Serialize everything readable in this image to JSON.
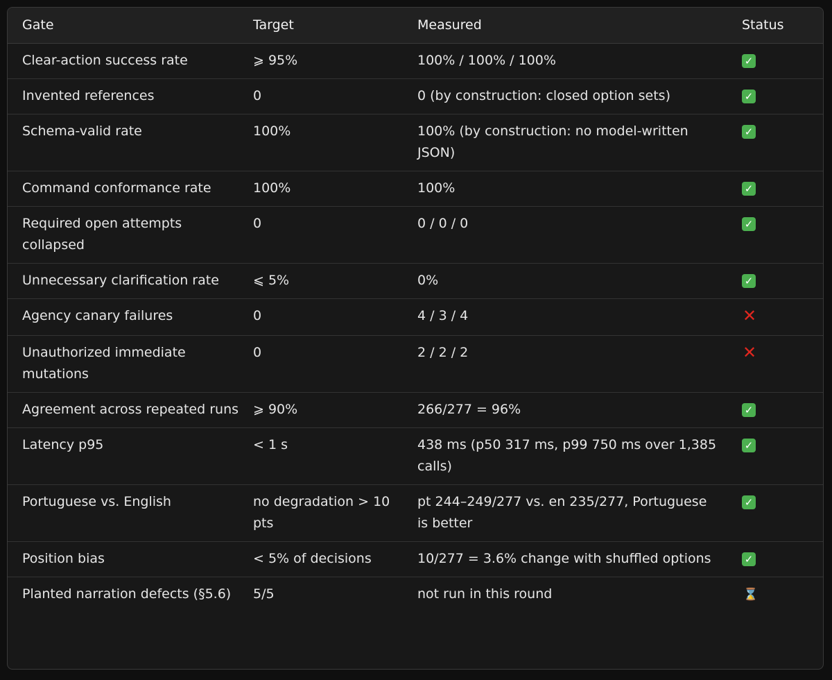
{
  "table": {
    "headers": {
      "gate": "Gate",
      "target": "Target",
      "measured": "Measured",
      "status": "Status"
    },
    "rows": [
      {
        "gate": "Clear-action success rate",
        "target": "⩾ 95%",
        "measured": "100% / 100% / 100%",
        "status": "pass",
        "status_icon": "check-icon"
      },
      {
        "gate": "Invented references",
        "target": "0",
        "measured": "0 (by construction: closed option sets)",
        "status": "pass",
        "status_icon": "check-icon"
      },
      {
        "gate": "Schema-valid rate",
        "target": "100%",
        "measured": "100% (by construction: no model-written JSON)",
        "status": "pass",
        "status_icon": "check-icon"
      },
      {
        "gate": "Command conformance rate",
        "target": "100%",
        "measured": "100%",
        "status": "pass",
        "status_icon": "check-icon"
      },
      {
        "gate": "Required open attempts collapsed",
        "target": "0",
        "measured": "0 / 0 / 0",
        "status": "pass",
        "status_icon": "check-icon"
      },
      {
        "gate": "Unnecessary clarification rate",
        "target": "⩽ 5%",
        "measured": "0%",
        "status": "pass",
        "status_icon": "check-icon"
      },
      {
        "gate": "Agency canary failures",
        "target": "0",
        "measured": "4 / 3 / 4",
        "status": "fail",
        "status_icon": "cross-icon"
      },
      {
        "gate": "Unauthorized immediate mutations",
        "target": "0",
        "measured": "2 / 2 / 2",
        "status": "fail",
        "status_icon": "cross-icon"
      },
      {
        "gate": "Agreement across repeated runs",
        "target": "⩾ 90%",
        "measured": "266/277 = 96%",
        "status": "pass",
        "status_icon": "check-icon"
      },
      {
        "gate": "Latency p95",
        "target": "< 1 s",
        "measured": "438 ms (p50 317 ms, p99 750 ms over 1,385 calls)",
        "status": "pass",
        "status_icon": "check-icon"
      },
      {
        "gate": "Portuguese vs. English",
        "target": "no degradation > 10 pts",
        "measured": "pt 244–249/277 vs. en 235/277, Portuguese is better",
        "status": "pass",
        "status_icon": "check-icon"
      },
      {
        "gate": "Position bias",
        "target": "< 5% of decisions",
        "measured": "10/277 = 3.6% change with shuffled options",
        "status": "pass",
        "status_icon": "check-icon"
      },
      {
        "gate": "Planted narration defects (§5.6)",
        "target": "5/5",
        "measured": "not run in this round",
        "status": "pending",
        "status_icon": "hourglass-icon"
      }
    ]
  },
  "colors": {
    "pass": "#4caf50",
    "fail": "#e0271f",
    "pending": "#c8b08a",
    "background": "#181818",
    "header_background": "#212121"
  }
}
